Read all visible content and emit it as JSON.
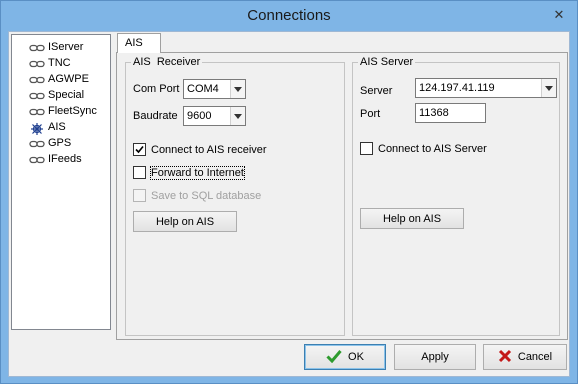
{
  "window": {
    "title": "Connections",
    "close_glyph": "✕"
  },
  "tree": {
    "items": [
      {
        "label": "IServer",
        "icon": "link-chain-icon"
      },
      {
        "label": "TNC",
        "icon": "link-chain-icon"
      },
      {
        "label": "AGWPE",
        "icon": "link-chain-icon"
      },
      {
        "label": "Special",
        "icon": "link-chain-icon"
      },
      {
        "label": "FleetSync",
        "icon": "link-chain-icon"
      },
      {
        "label": "AIS",
        "icon": "ship-wheel-icon"
      },
      {
        "label": "GPS",
        "icon": "link-chain-icon"
      },
      {
        "label": "IFeeds",
        "icon": "link-chain-icon"
      }
    ]
  },
  "tab": {
    "label": "AIS"
  },
  "receiver": {
    "title": "AIS  Receiver",
    "com_port_label": "Com Port",
    "com_port_value": "COM4",
    "baudrate_label": "Baudrate",
    "baudrate_value": "9600",
    "connect_label": "Connect to AIS receiver",
    "connect_checked": true,
    "forward_label": "Forward to Internet",
    "forward_checked": false,
    "sql_label": "Save to SQL database",
    "sql_checked": false,
    "help_label": "Help on AIS"
  },
  "server": {
    "title": "AIS Server",
    "server_label": "Server",
    "server_value": "124.197.41.119",
    "port_label": "Port",
    "port_value": "11368",
    "connect_label": "Connect to AIS Server",
    "connect_checked": false,
    "help_label": "Help on AIS"
  },
  "footer": {
    "ok_label": "OK",
    "apply_label": "Apply",
    "cancel_label": "Cancel"
  },
  "colors": {
    "title_bar": "#7fb5e6",
    "ok_icon": "#2e9b2e",
    "cancel_icon": "#c41a1a"
  }
}
